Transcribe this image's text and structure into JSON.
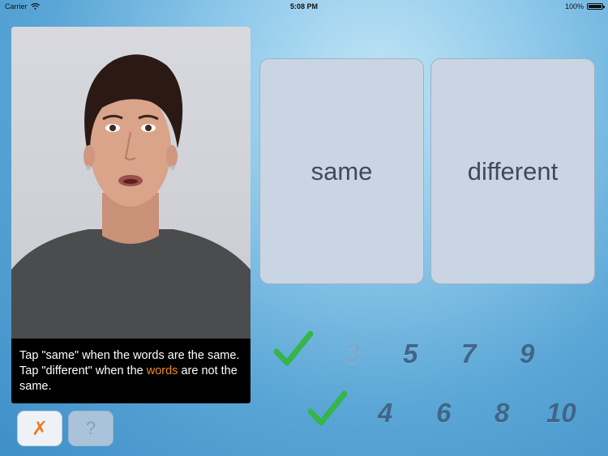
{
  "statusbar": {
    "carrier": "Carrier",
    "time": "5:08 PM",
    "battery": "100%",
    "battery_level": 1.0
  },
  "video": {
    "caption_before": "Tap \"same\" when the words are the same. Tap \"different\" when the ",
    "caption_highlight": "words",
    "caption_after": " are not the same."
  },
  "answers": {
    "same": "same",
    "different": "different"
  },
  "controls": {
    "close_label": "✗",
    "help_label": "?"
  },
  "progress": {
    "top_row": [
      {
        "label": "✓",
        "state": "correct"
      },
      {
        "label": "3",
        "state": "current"
      },
      {
        "label": "5"
      },
      {
        "label": "7"
      },
      {
        "label": "9"
      }
    ],
    "bottom_row": [
      {
        "label": "✓",
        "state": "correct"
      },
      {
        "label": "4"
      },
      {
        "label": "6"
      },
      {
        "label": "8"
      },
      {
        "label": "10"
      }
    ]
  },
  "colors": {
    "check": "#35b54a",
    "highlight": "#f08a24",
    "number": "#3f6688"
  }
}
